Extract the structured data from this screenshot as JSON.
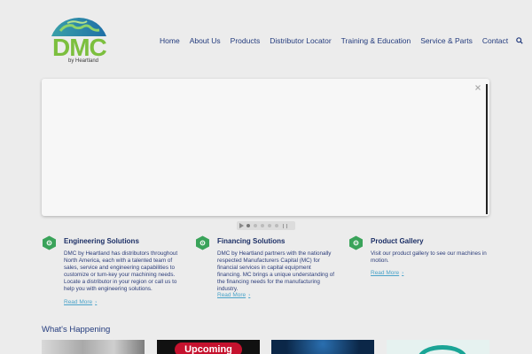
{
  "brand": {
    "logo_text": "DMC",
    "tagline": "by Heartland",
    "accent_green": "#7cbf3e",
    "accent_blue": "#233b7d",
    "link_color": "#4aa3c9"
  },
  "nav": {
    "items": [
      {
        "label": "Home"
      },
      {
        "label": "About Us"
      },
      {
        "label": "Products"
      },
      {
        "label": "Distributor Locator"
      },
      {
        "label": "Training & Education"
      },
      {
        "label": "Service & Parts"
      },
      {
        "label": "Contact"
      }
    ],
    "search_icon": "search-icon"
  },
  "slider": {
    "close_icon": "close-icon",
    "controls": [
      "play-icon",
      "dot",
      "dot",
      "dot",
      "dot",
      "dot",
      "pause-icon"
    ],
    "active_index": 0
  },
  "features": [
    {
      "icon": "gear-hex-icon",
      "title": "Engineering Solutions",
      "text": "DMC by Heartland has distributors throughout North America, each with a talented team of sales, service and engineering capabilities to customize or turn-key your machining needs. Locate a distributor in your region or call us to help you with engineering solutions.",
      "link": "Read More"
    },
    {
      "icon": "gear-hex-icon",
      "title": "Financing Solutions",
      "text": "DMC by Heartland partners with the nationally respected Manufacturers Capital (MC) for financial services in capital equipment financing. MC brings a unique understanding of the financing needs for the manufacturing industry.",
      "link": "Read More"
    },
    {
      "icon": "gear-hex-icon",
      "title": "Product Gallery",
      "text": "Visit our product gallery to see our machines in motion.",
      "link": "Read More"
    }
  ],
  "happening": {
    "heading": "What's Happening",
    "thumbs": [
      {
        "label": ""
      },
      {
        "label": "Upcoming"
      },
      {
        "label": ""
      },
      {
        "label": ""
      }
    ]
  }
}
